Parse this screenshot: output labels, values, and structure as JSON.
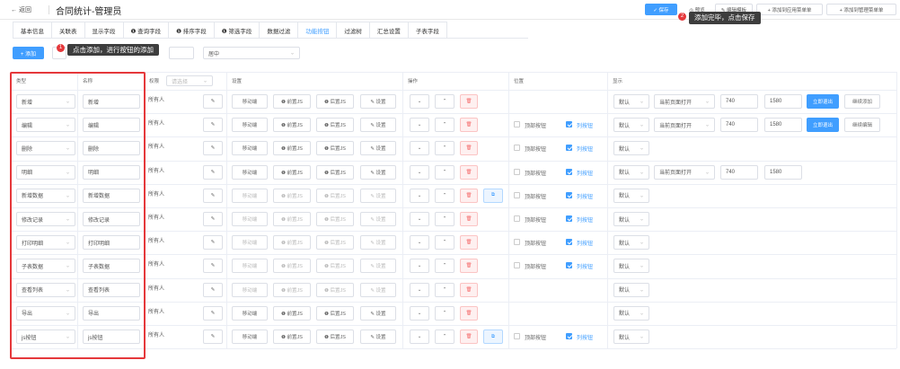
{
  "header": {
    "back_label": "← 返回",
    "title": "合同统计-管理员",
    "buttons": {
      "save": "✓ 保存",
      "preview": "◎ 预览",
      "edit_template": "✎ 编辑模板",
      "add_app_menu": "+ 添加到应用菜单单",
      "add_admin_menu": "+ 添加到管理菜单单"
    }
  },
  "tooltips": {
    "add": {
      "num": "1",
      "text": "点击添加，进行按钮的添加"
    },
    "save": {
      "num": "2",
      "text": "添加完毕，点击保存"
    }
  },
  "tabs": [
    "基本信息",
    "关联表",
    "显示字段",
    "❶ 查询字段",
    "❶ 排序字段",
    "❶ 筛选字段",
    "数据过滤",
    "功能按钮",
    "过滤树",
    "汇总设置",
    "子表字段"
  ],
  "active_tab": 7,
  "toolbar": {
    "add_label": "+ 添加",
    "align_value": "居中"
  },
  "columns": {
    "type": "类型",
    "name": "名称",
    "perm": "权限",
    "perm_placeholder": "请选择",
    "settings": "设置",
    "ops": "操作",
    "position": "位置",
    "display": "显示"
  },
  "labels": {
    "move": "移动端",
    "pre_js": "❶ 前置JS",
    "post_js": "❶ 后置JS",
    "setting": "✎ 设置",
    "top_btn": "顶部按钮",
    "row_btn": "列按钮",
    "default": "默认",
    "open_current": "当前页面打开",
    "perm_all": "所有人"
  },
  "rows": [
    {
      "type": "新增",
      "name": "新增",
      "sizes": {
        "w": "740",
        "h": "1580"
      },
      "open": true,
      "b1": "立即退出",
      "b2": "继续添加",
      "pos": false,
      "ext": false,
      "dim": false
    },
    {
      "type": "编辑",
      "name": "编辑",
      "sizes": {
        "w": "740",
        "h": "1580"
      },
      "open": true,
      "b1": "立即退出",
      "b2": "继续编辑",
      "pos": true,
      "ext": false,
      "dim": false
    },
    {
      "type": "删除",
      "name": "删除",
      "open": false,
      "pos": true,
      "ext": false,
      "dim": false
    },
    {
      "type": "明细",
      "name": "明细",
      "sizes": {
        "w": "740",
        "h": "1580"
      },
      "open": true,
      "pos": true,
      "ext": false,
      "dim": false
    },
    {
      "type": "新增数据",
      "name": "新增数据",
      "open": false,
      "pos": true,
      "ext": true,
      "dim": true
    },
    {
      "type": "修改记录",
      "name": "修改记录",
      "open": false,
      "pos": true,
      "ext": false,
      "dim": true
    },
    {
      "type": "打印明细",
      "name": "打印明细",
      "open": false,
      "pos": true,
      "ext": false,
      "dim": true
    },
    {
      "type": "子表数据",
      "name": "子表数据",
      "open": false,
      "pos": true,
      "ext": false,
      "dim": true
    },
    {
      "type": "查看列表",
      "name": "查看列表",
      "open": false,
      "pos": false,
      "ext": false,
      "dim": true
    },
    {
      "type": "导出",
      "name": "导出",
      "open": false,
      "pos": false,
      "ext": false,
      "dim": false
    },
    {
      "type": "js按钮",
      "name": "js按钮",
      "open": false,
      "pos": true,
      "ext": true,
      "dim": false
    }
  ]
}
